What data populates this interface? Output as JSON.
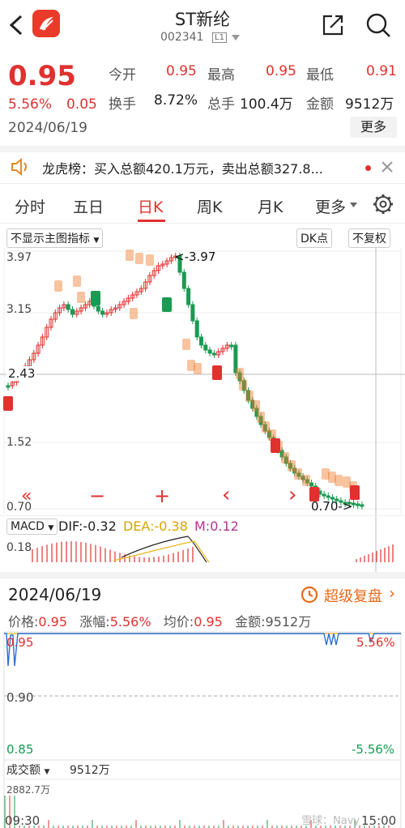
{
  "header": {
    "title": "ST新纶",
    "code": "002341",
    "badge": "L1",
    "back_icon": "chevron-left-icon",
    "logo_icon": "app-logo-icon",
    "share_icon": "share-icon",
    "search_icon": "search-icon"
  },
  "quote": {
    "price": "0.95",
    "change_pct": "5.56%",
    "change_abs": "0.05",
    "date": "2024/06/19",
    "fields": [
      {
        "label": "今开",
        "value": "0.95",
        "color": "red"
      },
      {
        "label": "最高",
        "value": "0.95",
        "color": "red"
      },
      {
        "label": "最低",
        "value": "0.91",
        "color": "red"
      },
      {
        "label": "换手",
        "value": "8.72%",
        "color": "black"
      },
      {
        "label": "总手",
        "value": "100.4万",
        "color": "black"
      },
      {
        "label": "金额",
        "value": "9512万",
        "color": "black"
      }
    ],
    "more_label": "更多"
  },
  "news": {
    "icon": "speaker-icon",
    "text": "龙虎榜：买入总额420.1万元，卖出总额327.8...",
    "close_icon": "close-icon"
  },
  "tabs": [
    {
      "label": "分时",
      "active": false
    },
    {
      "label": "五日",
      "active": false
    },
    {
      "label": "日K",
      "active": true
    },
    {
      "label": "周K",
      "active": false
    },
    {
      "label": "月K",
      "active": false
    },
    {
      "label": "更多",
      "active": false
    }
  ],
  "settings_icon": "gear-icon",
  "kline": {
    "indicator_select": "不显示主图指标",
    "dk_label": "DK点",
    "fq_label": "不复权",
    "y_ticks": [
      "3.97",
      "3.15",
      "2.43",
      "1.52",
      "0.70"
    ],
    "max_label": "3.97",
    "min_label": "0.70",
    "tools": [
      "«",
      "−",
      "+",
      "‹",
      "›"
    ],
    "macd": {
      "name": "MACD",
      "dif_label": "DIF:",
      "dif": "-0.32",
      "dea_label": "DEA:",
      "dea": "-0.38",
      "m_label": "M:",
      "m": "0.12",
      "top_tick": "0.18"
    }
  },
  "intraday": {
    "date": "2024/06/19",
    "replay_label": "超级复盘",
    "stats": [
      {
        "label": "价格:",
        "value": "0.95"
      },
      {
        "label": "涨幅:",
        "value": "5.56%"
      },
      {
        "label": "均价:",
        "value": "0.95"
      },
      {
        "label": "金额:",
        "value": "9512万"
      }
    ],
    "y_left_top": "0.95",
    "y_left_mid": "0.90",
    "y_left_bot": "0.85",
    "y_right_top": "5.56%",
    "y_right_bot": "-5.56%",
    "vol_select": "成交额",
    "vol_value": "9512万",
    "vol_tick": "2882.7万",
    "time_start": "09:30",
    "time_end": "15:00",
    "watermark": "雪球：Navy"
  },
  "chart_data": {
    "type": "candlestick",
    "title": "",
    "y_ticks": [
      3.97,
      3.15,
      2.43,
      1.52,
      0.7
    ],
    "ylim": [
      0.7,
      3.97
    ],
    "annotations": [
      "<-3.97",
      "0.70->"
    ]
  },
  "colors": {
    "up": "#e0312f",
    "down": "#1a9a52",
    "accent": "#e0312f",
    "orange": "#f07a2a",
    "macd_dif": "#222222",
    "macd_dea": "#e8b818"
  }
}
